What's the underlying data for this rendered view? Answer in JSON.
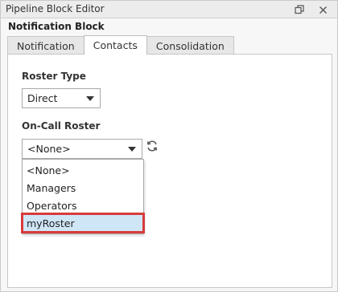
{
  "window": {
    "title": "Pipeline Block Editor",
    "restore_icon": "restore-window-icon",
    "close_icon": "close-icon"
  },
  "section": {
    "title": "Notification Block"
  },
  "tabs": [
    {
      "label": "Notification",
      "active": false
    },
    {
      "label": "Contacts",
      "active": true
    },
    {
      "label": "Consolidation",
      "active": false
    }
  ],
  "roster_type": {
    "label": "Roster Type",
    "value": "Direct"
  },
  "on_call_roster": {
    "label": "On-Call Roster",
    "value": "<None>",
    "refresh_icon": "refresh-icon",
    "options": [
      "<None>",
      "Managers",
      "Operators",
      "myRoster"
    ],
    "highlighted_option": "myRoster"
  },
  "colors": {
    "highlight_border": "#d93a3a",
    "selected_option_bg": "#cfe6f7"
  }
}
